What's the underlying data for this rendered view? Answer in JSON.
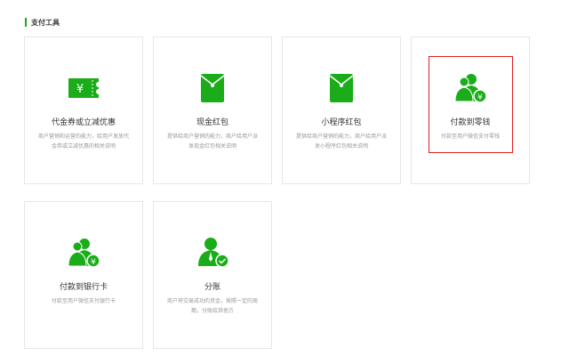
{
  "section": {
    "title": "支付工具"
  },
  "colors": {
    "accent": "#1aad19",
    "highlight": "#e02020"
  },
  "cards": [
    {
      "title": "代金券或立减优惠",
      "desc": "商户营销和运营的能力，给用户发放代金券或立减优惠的相关说明",
      "icon": "coupon-icon"
    },
    {
      "title": "现金红包",
      "desc": "提供给商户营销的能力，商户给用户派发现金红包相关说明",
      "icon": "red-packet-icon"
    },
    {
      "title": "小程序红包",
      "desc": "提供给商户营销的能力，商户给用户派发小程序红包相关说明",
      "icon": "red-packet-icon"
    },
    {
      "title": "付款到零钱",
      "desc": "付款至用户微信支付零钱",
      "icon": "users-yen-icon"
    },
    {
      "title": "付款到银行卡",
      "desc": "付款至用户微信支付银行卡",
      "icon": "users-yen-icon"
    },
    {
      "title": "分账",
      "desc": "商户将交易成功的资金，按照一定的周期，分账给其他方",
      "icon": "user-check-icon"
    }
  ]
}
